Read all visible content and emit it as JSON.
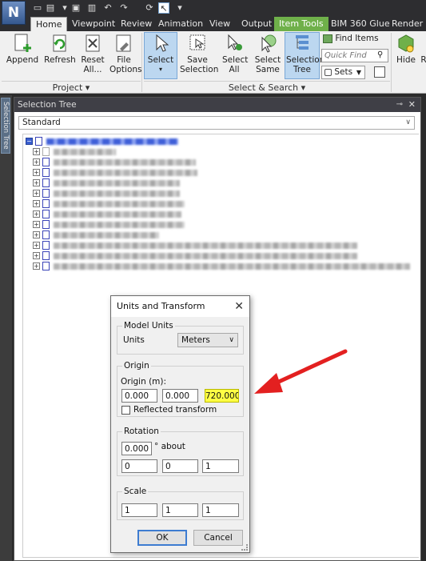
{
  "app": {
    "logo_letter": "N"
  },
  "tabs": [
    {
      "label": "Home",
      "active": true
    },
    {
      "label": "Viewpoint"
    },
    {
      "label": "Review"
    },
    {
      "label": "Animation"
    },
    {
      "label": "View"
    },
    {
      "label": "Output"
    },
    {
      "label": "Item Tools",
      "context": true
    },
    {
      "label": "BIM 360 Glue"
    },
    {
      "label": "Render"
    }
  ],
  "ribbon": {
    "append": "Append",
    "refresh": "Refresh",
    "reset_all": "Reset All...",
    "file_options": "File Options",
    "select": "Select",
    "save_selection": "Save Selection",
    "select_all": "Select All",
    "select_same": "Select Same",
    "selection_tree": "Selection Tree",
    "find_items": "Find Items",
    "quick_find_placeholder": "Quick Find",
    "sets": "Sets",
    "hide": "Hide",
    "partial_right": "R",
    "group_project": "Project",
    "group_select_search": "Select & Search"
  },
  "side_tab": {
    "label": "Selection Tree"
  },
  "panel": {
    "title": "Selection Tree",
    "dropdown_value": "Standard",
    "tree_rows": 14
  },
  "dialog": {
    "title": "Units and Transform",
    "model_units": {
      "legend": "Model Units",
      "units_label": "Units",
      "units_value": "Meters"
    },
    "origin": {
      "legend": "Origin",
      "label": "Origin (m):",
      "x": "0.000",
      "y": "0.000",
      "z": "720.000",
      "reflected_label": "Reflected transform"
    },
    "rotation": {
      "legend": "Rotation",
      "angle": "0.000",
      "about_label": "° about",
      "axis_x": "0",
      "axis_y": "0",
      "axis_z": "1"
    },
    "scale": {
      "legend": "Scale",
      "x": "1",
      "y": "1",
      "z": "1"
    },
    "ok": "OK",
    "cancel": "Cancel"
  },
  "colors": {
    "highlight": "#ffff2a",
    "annotation_arrow": "#e32020",
    "selected_button": "#bcd7f0",
    "context_tab": "#6fb04a"
  }
}
